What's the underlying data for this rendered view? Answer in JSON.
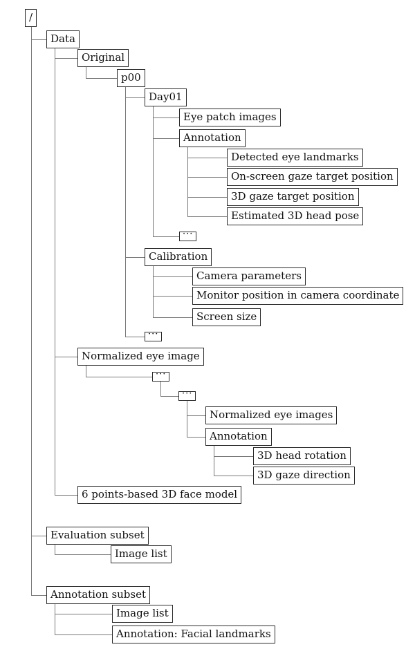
{
  "diagram_type": "directory-tree",
  "nodes": [
    {
      "id": "root",
      "label": "/",
      "parent": null
    },
    {
      "id": "data",
      "label": "Data",
      "parent": "root"
    },
    {
      "id": "original",
      "label": "Original",
      "parent": "data"
    },
    {
      "id": "p00",
      "label": "p00",
      "parent": "original"
    },
    {
      "id": "day01",
      "label": "Day01",
      "parent": "p00"
    },
    {
      "id": "eye-patch",
      "label": "Eye patch images",
      "parent": "day01"
    },
    {
      "id": "annotation1",
      "label": "Annotation",
      "parent": "day01"
    },
    {
      "id": "detected",
      "label": "Detected eye landmarks",
      "parent": "annotation1"
    },
    {
      "id": "onscreen",
      "label": "On-screen gaze target position",
      "parent": "annotation1"
    },
    {
      "id": "gaze3d",
      "label": "3D gaze target position",
      "parent": "annotation1"
    },
    {
      "id": "headpose",
      "label": "Estimated 3D head pose",
      "parent": "annotation1"
    },
    {
      "id": "dots1",
      "label": "···",
      "parent": "day01"
    },
    {
      "id": "calibration",
      "label": "Calibration",
      "parent": "p00"
    },
    {
      "id": "camparams",
      "label": "Camera parameters",
      "parent": "calibration"
    },
    {
      "id": "monitor",
      "label": "Monitor position in camera coordinate",
      "parent": "calibration"
    },
    {
      "id": "screensize",
      "label": "Screen size",
      "parent": "calibration"
    },
    {
      "id": "dots2",
      "label": "···",
      "parent": "p00"
    },
    {
      "id": "normalized",
      "label": "Normalized eye image",
      "parent": "data"
    },
    {
      "id": "dots3",
      "label": "···",
      "parent": "normalized"
    },
    {
      "id": "dots4",
      "label": "···",
      "parent": "dots3"
    },
    {
      "id": "normimages",
      "label": "Normalized eye images",
      "parent": "dots4"
    },
    {
      "id": "annotation2",
      "label": "Annotation",
      "parent": "dots4"
    },
    {
      "id": "headrot",
      "label": "3D head rotation",
      "parent": "annotation2"
    },
    {
      "id": "gazedir",
      "label": "3D gaze direction",
      "parent": "annotation2"
    },
    {
      "id": "facemodel",
      "label": "6 points-based 3D face model",
      "parent": "data"
    },
    {
      "id": "evalsubset",
      "label": "Evaluation subset",
      "parent": "root"
    },
    {
      "id": "evalimglist",
      "label": "Image list",
      "parent": "evalsubset"
    },
    {
      "id": "annsubset",
      "label": "Annotation subset",
      "parent": "root"
    },
    {
      "id": "annimglist",
      "label": "Image list",
      "parent": "annsubset"
    },
    {
      "id": "facial",
      "label": "Annotation: Facial landmarks",
      "parent": "annsubset"
    }
  ],
  "colors": {
    "box_border": "#2a2a2a",
    "connector": "#777777",
    "text": "#111111"
  }
}
